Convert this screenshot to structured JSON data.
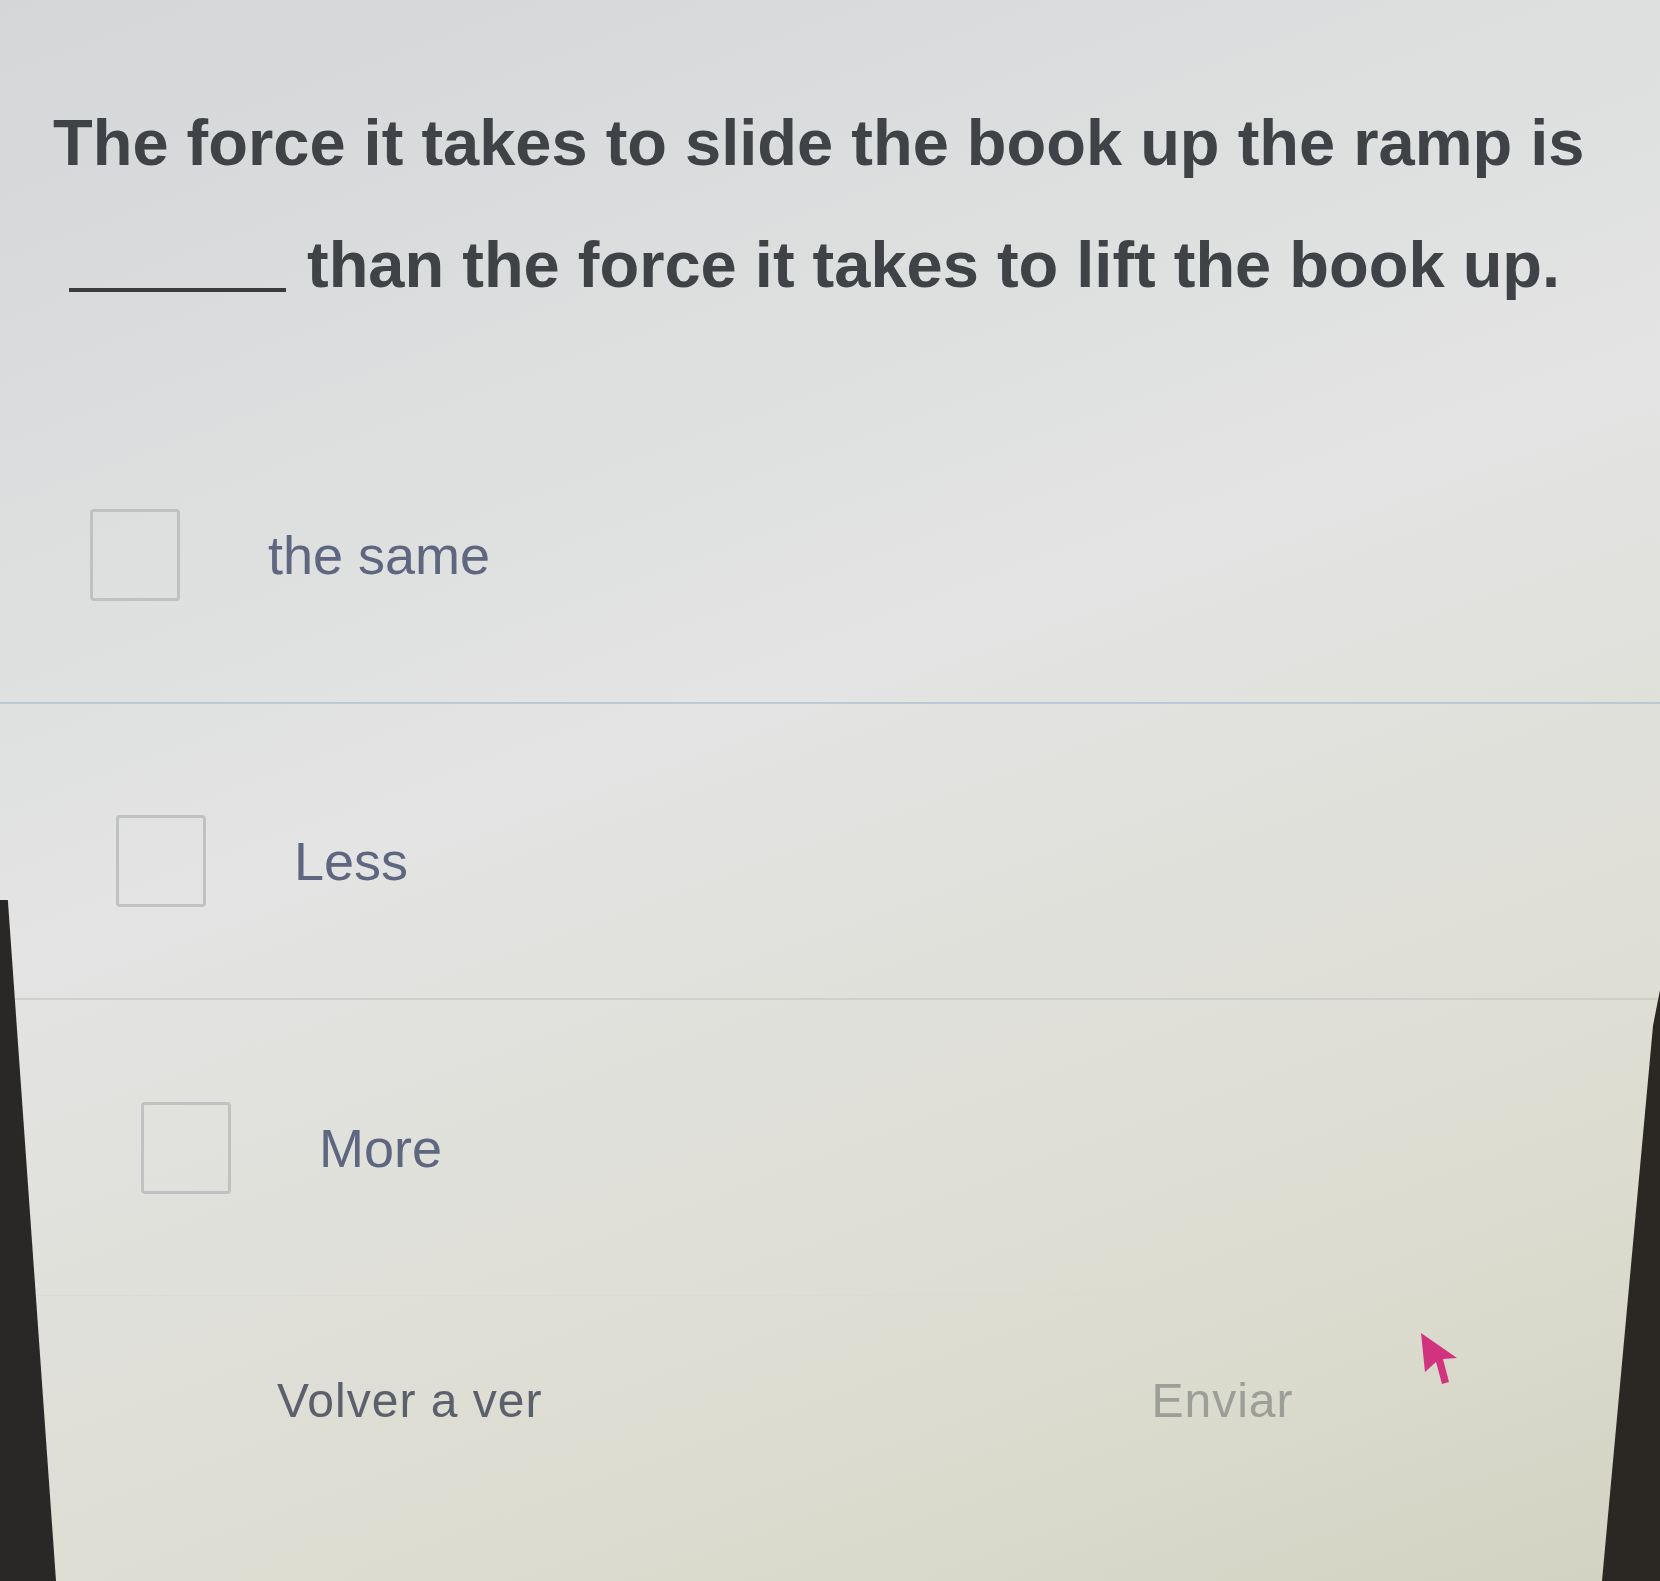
{
  "question": {
    "text_before": "The force it takes to slide the book up the ramp is",
    "text_after": "than the force it takes to lift the book up."
  },
  "options": [
    {
      "label": "the same",
      "checked": false
    },
    {
      "label": "Less",
      "checked": false
    },
    {
      "label": "More",
      "checked": false
    }
  ],
  "buttons": [
    {
      "label": "Volver a ver",
      "disabled": false
    },
    {
      "label": "Enviar",
      "disabled": true
    }
  ]
}
